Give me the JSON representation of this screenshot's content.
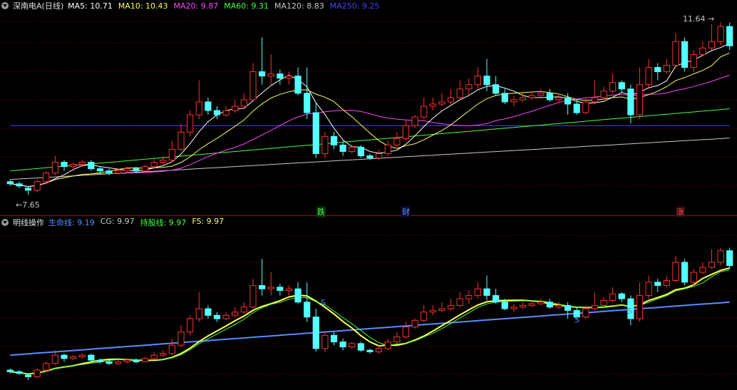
{
  "main_panel": {
    "title": "深南电A(日线)",
    "indicators": [
      {
        "label": "MA5:",
        "value": "10.71",
        "color": "#ffffff"
      },
      {
        "label": "MA10:",
        "value": "10.43",
        "color": "#ffff55"
      },
      {
        "label": "MA20:",
        "value": "9.87",
        "color": "#ff44ff"
      },
      {
        "label": "MA60:",
        "value": "9.31",
        "color": "#44ff44"
      },
      {
        "label": "MA120:",
        "value": "8.83",
        "color": "#c8c8c8"
      },
      {
        "label": "MA250:",
        "value": "9.25",
        "color": "#4444ff"
      }
    ],
    "high_label": "11.64",
    "low_label": "7.65",
    "event_markers": [
      "跌",
      "财",
      "涨"
    ]
  },
  "sub_panel": {
    "title": "明线操作",
    "indicators": [
      {
        "label": "生命线:",
        "value": "9.19",
        "color": "#5a8cff"
      },
      {
        "label": "CG:",
        "value": "9.97",
        "color": "#c8c8c8"
      },
      {
        "label": "持股线:",
        "value": "9.97",
        "color": "#44ff44"
      },
      {
        "label": "FS:",
        "value": "9.97",
        "color": "#ffff55"
      }
    ],
    "signal_markers": [
      "S",
      "S",
      "S"
    ]
  },
  "colors": {
    "up": "#ff3030",
    "down": "#54ffff",
    "bg": "#000000",
    "grid": "#7a1010"
  },
  "chart_data": {
    "type": "candlestick",
    "candles": [
      [
        7.95,
        7.9,
        8.0,
        7.85
      ],
      [
        7.9,
        7.85,
        7.95,
        7.8
      ],
      [
        7.8,
        7.75,
        7.85,
        7.65
      ],
      [
        7.75,
        7.95,
        8.0,
        7.7
      ],
      [
        7.95,
        8.15,
        8.2,
        7.9
      ],
      [
        8.15,
        8.4,
        8.55,
        8.1
      ],
      [
        8.4,
        8.3,
        8.45,
        8.2
      ],
      [
        8.3,
        8.35,
        8.4,
        8.25
      ],
      [
        8.35,
        8.4,
        8.45,
        8.3
      ],
      [
        8.4,
        8.25,
        8.45,
        8.2
      ],
      [
        8.25,
        8.2,
        8.3,
        8.15
      ],
      [
        8.2,
        8.15,
        8.25,
        8.1
      ],
      [
        8.15,
        8.2,
        8.25,
        8.1
      ],
      [
        8.2,
        8.25,
        8.3,
        8.15
      ],
      [
        8.25,
        8.2,
        8.3,
        8.15
      ],
      [
        8.2,
        8.3,
        8.35,
        8.2
      ],
      [
        8.3,
        8.4,
        8.5,
        8.25
      ],
      [
        8.4,
        8.45,
        8.55,
        8.35
      ],
      [
        8.45,
        8.7,
        8.9,
        8.4
      ],
      [
        8.7,
        9.1,
        9.3,
        8.65
      ],
      [
        9.1,
        9.5,
        9.6,
        9.0
      ],
      [
        9.5,
        9.8,
        10.3,
        9.4
      ],
      [
        9.8,
        9.6,
        9.9,
        9.5
      ],
      [
        9.6,
        9.5,
        9.7,
        9.4
      ],
      [
        9.5,
        9.6,
        9.7,
        9.45
      ],
      [
        9.6,
        9.7,
        9.85,
        9.55
      ],
      [
        9.7,
        9.85,
        10.0,
        9.65
      ],
      [
        9.85,
        10.5,
        10.7,
        9.8
      ],
      [
        10.5,
        10.4,
        11.3,
        10.2
      ],
      [
        10.4,
        10.45,
        10.9,
        10.2
      ],
      [
        10.45,
        10.35,
        10.55,
        10.2
      ],
      [
        10.35,
        10.4,
        10.5,
        10.2
      ],
      [
        10.4,
        10.0,
        10.6,
        9.95
      ],
      [
        10.0,
        9.55,
        10.6,
        9.4
      ],
      [
        9.55,
        8.6,
        9.8,
        8.5
      ],
      [
        8.6,
        9.0,
        9.1,
        8.5
      ],
      [
        9.0,
        8.8,
        9.1,
        8.7
      ],
      [
        8.8,
        8.65,
        8.9,
        8.55
      ],
      [
        8.65,
        8.75,
        8.8,
        8.6
      ],
      [
        8.75,
        8.55,
        8.8,
        8.5
      ],
      [
        8.55,
        8.5,
        8.6,
        8.45
      ],
      [
        8.5,
        8.6,
        8.7,
        8.45
      ],
      [
        8.6,
        8.8,
        8.9,
        8.55
      ],
      [
        8.8,
        8.95,
        9.1,
        8.75
      ],
      [
        8.95,
        9.25,
        9.4,
        8.9
      ],
      [
        9.25,
        9.45,
        9.5,
        9.2
      ],
      [
        9.45,
        9.7,
        9.9,
        9.4
      ],
      [
        9.7,
        9.75,
        9.9,
        9.6
      ],
      [
        9.75,
        9.8,
        10.0,
        9.7
      ],
      [
        9.8,
        9.9,
        10.1,
        9.75
      ],
      [
        9.9,
        10.1,
        10.3,
        9.85
      ],
      [
        10.1,
        10.2,
        10.35,
        9.95
      ],
      [
        10.2,
        10.4,
        10.6,
        10.1
      ],
      [
        10.4,
        10.2,
        10.8,
        10.05
      ],
      [
        10.2,
        10.0,
        10.4,
        9.95
      ],
      [
        10.0,
        9.8,
        10.1,
        9.75
      ],
      [
        9.8,
        9.85,
        9.95,
        9.7
      ],
      [
        9.85,
        9.9,
        10.0,
        9.8
      ],
      [
        9.9,
        9.95,
        10.05,
        9.85
      ],
      [
        9.95,
        10.0,
        10.1,
        9.9
      ],
      [
        10.0,
        9.85,
        10.1,
        9.8
      ],
      [
        9.85,
        9.9,
        10.0,
        9.8
      ],
      [
        9.9,
        9.75,
        10.0,
        9.5
      ],
      [
        9.75,
        9.55,
        9.85,
        9.5
      ],
      [
        9.55,
        9.8,
        9.9,
        9.5
      ],
      [
        9.8,
        9.9,
        10.3,
        9.75
      ],
      [
        9.9,
        10.05,
        10.15,
        9.85
      ],
      [
        10.05,
        10.25,
        10.45,
        10.0
      ],
      [
        10.25,
        10.1,
        10.3,
        10.0
      ],
      [
        10.1,
        9.5,
        10.2,
        9.3
      ],
      [
        9.5,
        10.2,
        10.6,
        9.4
      ],
      [
        10.2,
        10.6,
        10.8,
        10.1
      ],
      [
        10.6,
        10.5,
        10.7,
        10.3
      ],
      [
        10.5,
        10.65,
        10.8,
        10.45
      ],
      [
        10.65,
        11.2,
        11.4,
        10.6
      ],
      [
        11.2,
        10.6,
        11.3,
        10.5
      ],
      [
        10.6,
        10.9,
        11.0,
        10.5
      ],
      [
        10.9,
        11.05,
        11.2,
        10.85
      ],
      [
        11.05,
        11.2,
        11.6,
        11.0
      ],
      [
        11.2,
        11.55,
        11.64,
        11.1
      ],
      [
        11.55,
        11.1,
        11.64,
        11.0
      ]
    ]
  }
}
